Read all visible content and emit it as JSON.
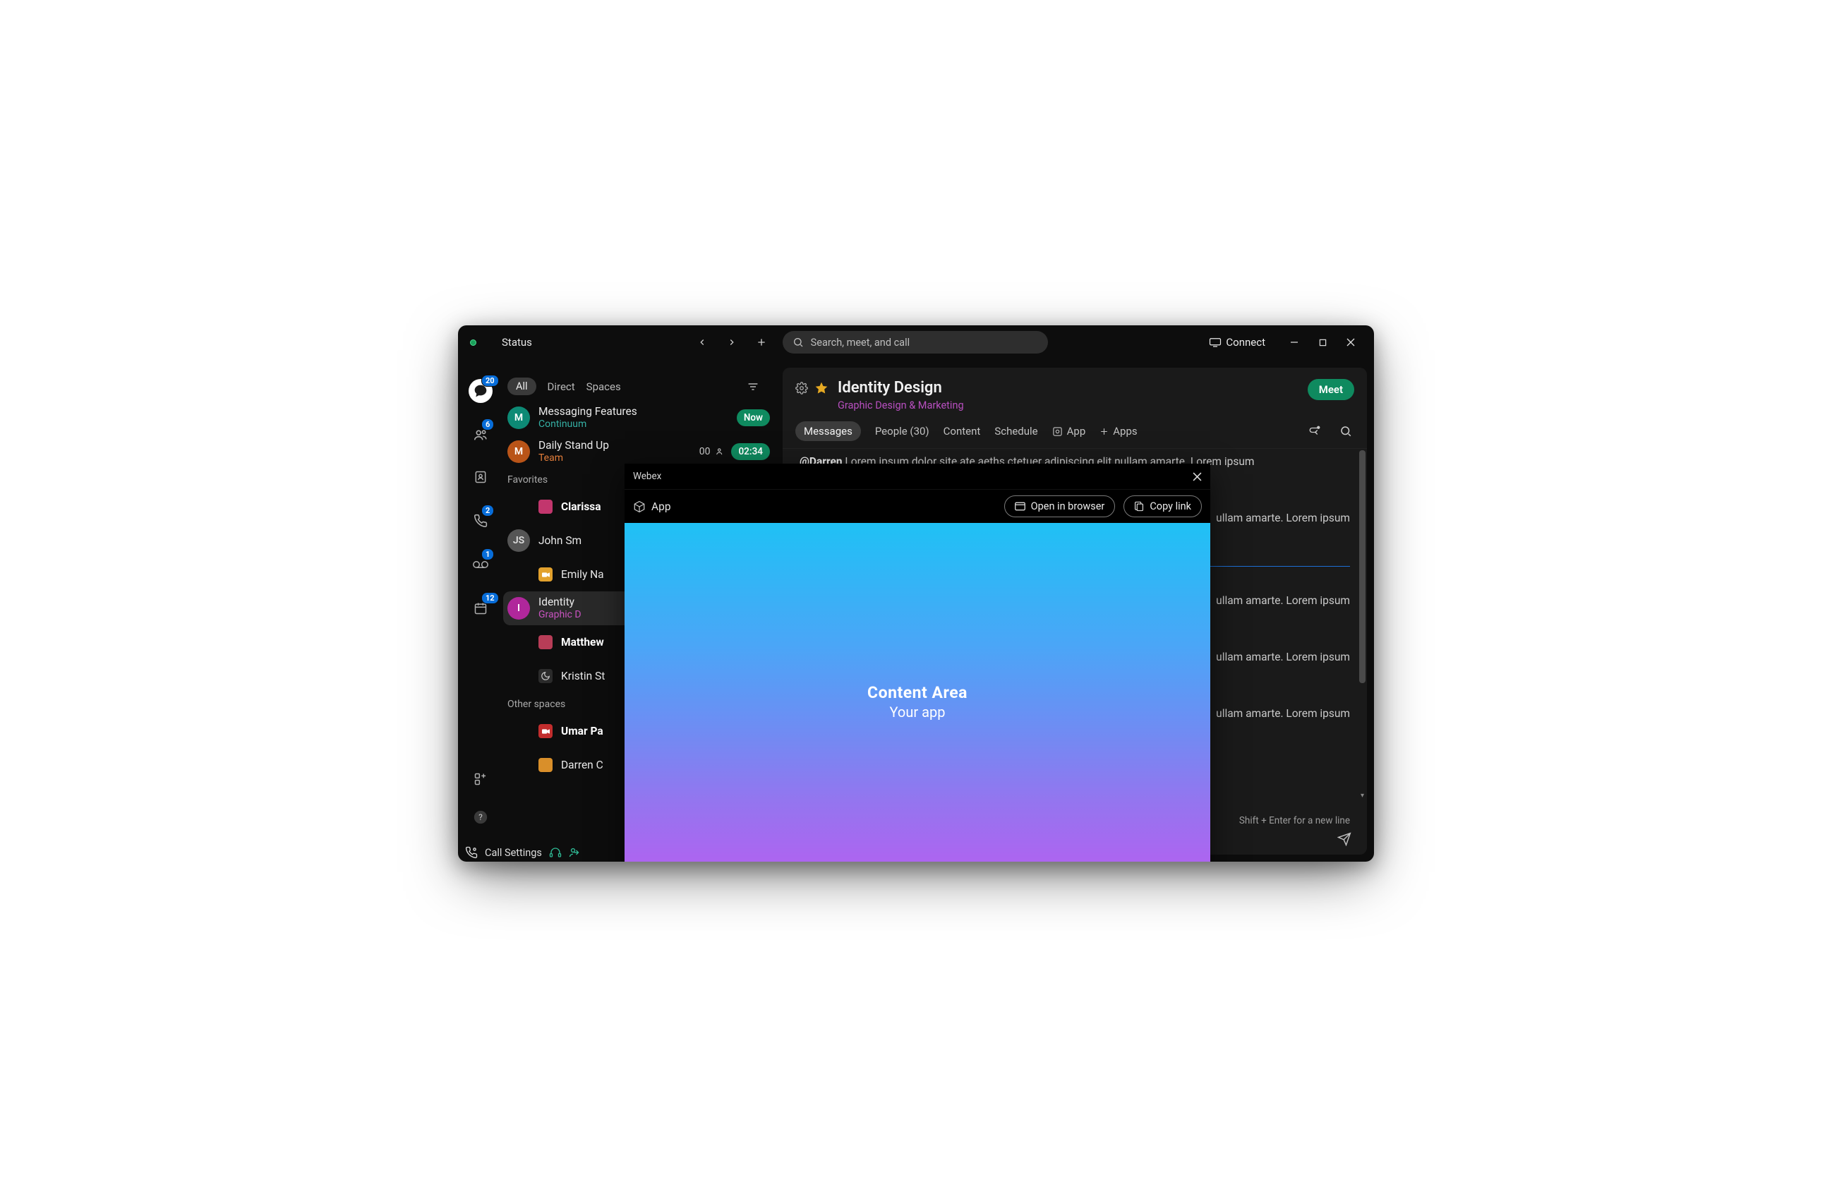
{
  "topbar": {
    "status": "Status",
    "search_placeholder": "Search, meet, and call",
    "connect": "Connect"
  },
  "rail": {
    "badges": {
      "messaging": "20",
      "teams": "6",
      "calls": "2",
      "voicemail": "1",
      "calendar": "12"
    }
  },
  "sidebar": {
    "tabs": {
      "all": "All",
      "direct": "Direct",
      "spaces": "Spaces"
    },
    "rows": [
      {
        "title": "Messaging Features",
        "sub": "Continuum",
        "badge": "Now"
      },
      {
        "title": "Daily Stand Up",
        "sub": "Team",
        "time": "02:34"
      }
    ],
    "fav_header": "Favorites",
    "favorites": [
      {
        "title": "Clarissa"
      },
      {
        "title": "John Sm"
      },
      {
        "title": "Emily Na"
      },
      {
        "title": "Identity",
        "sub": "Graphic D"
      },
      {
        "title": "Matthew"
      },
      {
        "title": "Kristin St"
      }
    ],
    "other_header": "Other spaces",
    "others": [
      {
        "title": "Umar Pa"
      },
      {
        "title": "Darren C"
      }
    ]
  },
  "bottom": {
    "call_settings": "Call Settings"
  },
  "main": {
    "title": "Identity Design",
    "subtitle": "Graphic Design & Marketing",
    "meet": "Meet",
    "tabs": {
      "messages": "Messages",
      "people": "People (30)",
      "content": "Content",
      "schedule": "Schedule",
      "app": "App",
      "apps": "Apps"
    },
    "mention": "@Darren",
    "msg_body": "Lorem ipsum dolor site ate aeths ctetuer adipiscing elit nullam amarte. Lorem ipsum",
    "msg_tail": "ullam amarte. Lorem ipsum",
    "composer_hint": "Shift + Enter for a new line"
  },
  "modal": {
    "title": "Webex",
    "app": "App",
    "open": "Open in browser",
    "copy": "Copy link",
    "line1": "Content Area",
    "line2": "Your app"
  }
}
